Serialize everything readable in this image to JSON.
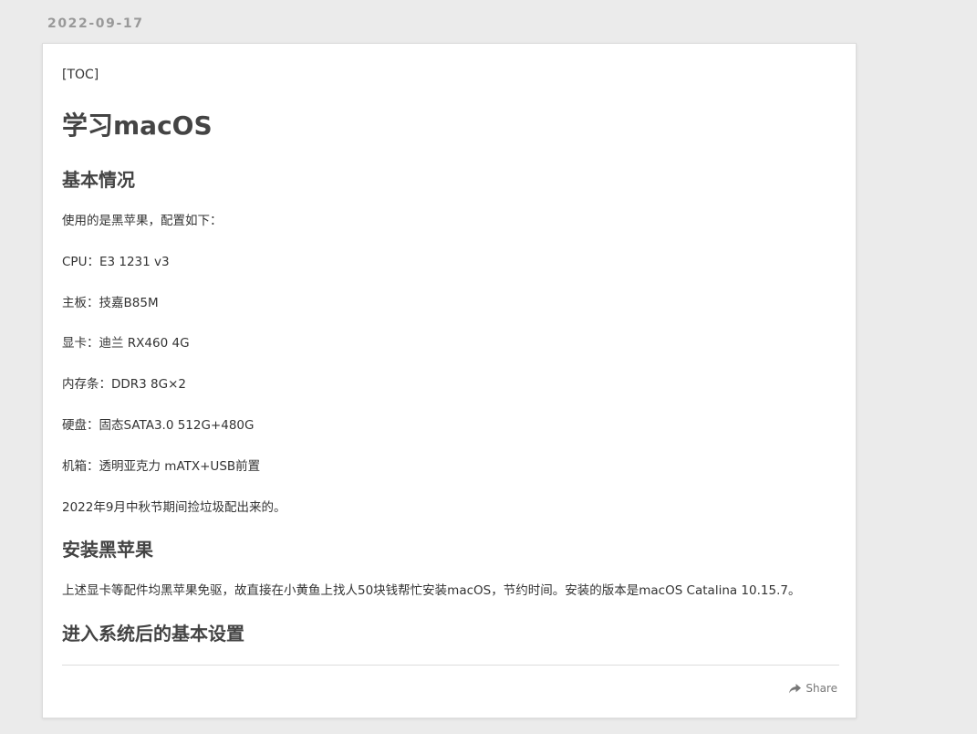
{
  "post": {
    "date": "2022-09-17",
    "toc": "[TOC]",
    "title": "学习macOS",
    "sections": {
      "s1_heading": "基本情况",
      "s1_intro": "使用的是黑苹果，配置如下：",
      "s1_cpu": "CPU：E3 1231 v3",
      "s1_board": "主板：技嘉B85M",
      "s1_gpu": "显卡：迪兰 RX460 4G",
      "s1_ram": "内存条：DDR3 8G×2",
      "s1_disk": "硬盘：固态SATA3.0 512G+480G",
      "s1_case": "机箱：透明亚克力 mATX+USB前置",
      "s1_note": "2022年9月中秋节期间捡垃圾配出来的。",
      "s2_heading": "安装黑苹果",
      "s2_text": "上述显卡等配件均黑苹果免驱，故直接在小黄鱼上找人50块钱帮忙安装macOS，节约时间。安装的版本是macOS Catalina 10.15.7。",
      "s3_heading": "进入系统后的基本设置"
    },
    "share_label": "Share"
  },
  "icons": {
    "share": "share-arrow-icon"
  }
}
